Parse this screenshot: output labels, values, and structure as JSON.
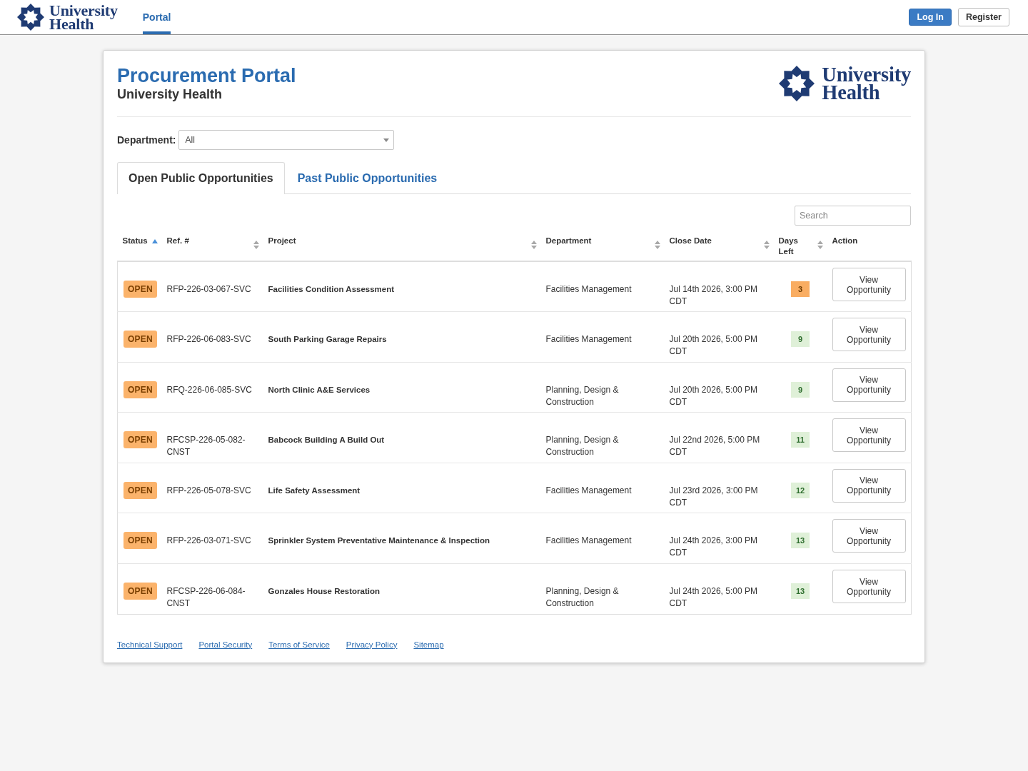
{
  "navbar": {
    "logo": [
      "University",
      "Health"
    ],
    "nav_items": [
      {
        "label": "Portal",
        "selected": true
      }
    ],
    "login_button": {
      "label": "Log In"
    },
    "register_button": {
      "label": "Register"
    }
  },
  "header": {
    "title": "Procurement Portal",
    "subtitle": "University Health",
    "logo": [
      "University",
      "Health"
    ]
  },
  "department_filter": {
    "label": "Department:",
    "value": "All"
  },
  "tabs": [
    {
      "label": "Open Public Opportunities",
      "selected": true
    },
    {
      "label": "Past Public Opportunities",
      "selected": false
    }
  ],
  "search": {
    "placeholder": "Search"
  },
  "table": {
    "columns": [
      {
        "label": "Status",
        "sortable": true,
        "sorted": true
      },
      {
        "label": "Ref. #",
        "sortable": true,
        "sorted": false
      },
      {
        "label": "Project",
        "sortable": true,
        "sorted": false
      },
      {
        "label": "Department",
        "sortable": true,
        "sorted": false
      },
      {
        "label": "Close Date",
        "sortable": true,
        "sorted": false
      },
      {
        "label": "Days Left",
        "sortable": true,
        "sorted": false
      },
      {
        "label": "Action",
        "sortable": false,
        "sorted": false
      }
    ],
    "rows": [
      {
        "status": "OPEN",
        "ref": "RFP-226-03-067-SVC",
        "project": "Facilities Condition Assessment",
        "department": "Facilities Management",
        "close_date": "Jul 14th 2026, 3:00 PM CDT",
        "days_left": "3",
        "urgent": true,
        "action": "View Opportunity"
      },
      {
        "status": "OPEN",
        "ref": "RFP-226-06-083-SVC",
        "project": "South Parking Garage Repairs",
        "department": "Facilities Management",
        "close_date": "Jul 20th 2026, 5:00 PM CDT",
        "days_left": "9",
        "urgent": false,
        "action": "View Opportunity"
      },
      {
        "status": "OPEN",
        "ref": "RFQ-226-06-085-SVC",
        "project": "North Clinic A&E Services",
        "department": "Planning, Design & Construction",
        "close_date": "Jul 20th 2026, 5:00 PM CDT",
        "days_left": "9",
        "urgent": false,
        "action": "View Opportunity"
      },
      {
        "status": "OPEN",
        "ref": "RFCSP-226-05-082-CNST",
        "project": "Babcock Building A Build Out",
        "department": "Planning, Design & Construction",
        "close_date": "Jul 22nd 2026, 5:00 PM CDT",
        "days_left": "11",
        "urgent": false,
        "action": "View Opportunity"
      },
      {
        "status": "OPEN",
        "ref": "RFP-226-05-078-SVC",
        "project": "Life Safety Assessment",
        "department": "Facilities Management",
        "close_date": "Jul 23rd 2026, 3:00 PM CDT",
        "days_left": "12",
        "urgent": false,
        "action": "View Opportunity"
      },
      {
        "status": "OPEN",
        "ref": "RFP-226-03-071-SVC",
        "project": "Sprinkler System Preventative Maintenance & Inspection",
        "department": "Facilities Management",
        "close_date": "Jul 24th 2026, 3:00 PM CDT",
        "days_left": "13",
        "urgent": false,
        "action": "View Opportunity"
      },
      {
        "status": "OPEN",
        "ref": "RFCSP-226-06-084-CNST",
        "project": "Gonzales House Restoration",
        "department": "Planning, Design & Construction",
        "close_date": "Jul 24th 2026, 5:00 PM CDT",
        "days_left": "13",
        "urgent": false,
        "action": "View Opportunity"
      }
    ]
  },
  "footer_links": [
    "Technical Support",
    "Portal Security",
    "Terms of Service",
    "Privacy Policy",
    "Sitemap"
  ]
}
